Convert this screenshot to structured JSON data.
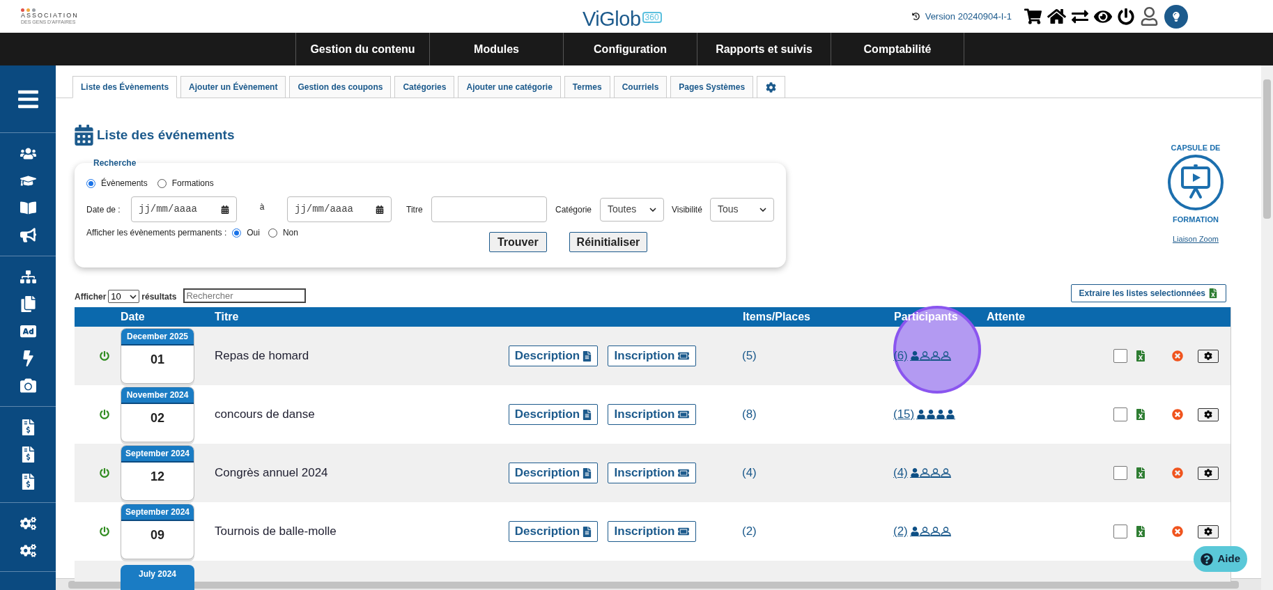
{
  "header": {
    "logo_title": "ASSOCIATION",
    "logo_subtitle": "DES GENS D'AFFAIRES",
    "brand": "ViGlob",
    "brand_badge": "360",
    "version": "Version 20240904-I-1"
  },
  "nav": [
    "Gestion du contenu",
    "Modules",
    "Configuration",
    "Rapports et suivis",
    "Comptabilité"
  ],
  "tabs": [
    {
      "label": "Liste des Évènements",
      "selected": true
    },
    {
      "label": "Ajouter un Évènement",
      "selected": false
    },
    {
      "label": "Gestion des coupons",
      "selected": false
    },
    {
      "label": "Catégories",
      "selected": false
    },
    {
      "label": "Ajouter une catégorie",
      "selected": false
    },
    {
      "label": "Termes",
      "selected": false
    },
    {
      "label": "Courriels",
      "selected": false
    },
    {
      "label": "Pages Systèmes",
      "selected": false
    }
  ],
  "page_title": "Liste des événements",
  "search": {
    "legend": "Recherche",
    "types": [
      {
        "label": "Évènements",
        "selected": true
      },
      {
        "label": "Formations",
        "selected": false
      }
    ],
    "date_from_label": "Date de :",
    "date_from_placeholder": "jj/mm/aaaa",
    "date_to_label": "à",
    "date_to_placeholder": "jj/mm/aaaa",
    "title_label": "Titre",
    "category_label": "Catégorie",
    "category_value": "Toutes",
    "visibility_label": "Visibilité",
    "visibility_value": "Tous",
    "permanent_label": "Afficher les évènements permanents :",
    "permanent_options": [
      {
        "label": "Oui",
        "selected": true
      },
      {
        "label": "Non",
        "selected": false
      }
    ],
    "find_button": "Trouver",
    "reset_button": "Réinitialiser"
  },
  "capsule": {
    "top": "CAPSULE DE",
    "bottom": "FORMATION",
    "link": "Liaison Zoom"
  },
  "show_label": "Afficher",
  "show_value": "10",
  "results_label": "résultats",
  "filter_placeholder": "Rechercher",
  "extract_button": "Extraire les listes selectionnées",
  "table": {
    "columns": [
      "Date",
      "Titre",
      "Items/Places",
      "Participants",
      "Attente"
    ],
    "rows": [
      {
        "active": true,
        "month": "December 2025",
        "day": "01",
        "title": "Repas de homard",
        "description": "Description",
        "inscription": "Inscription",
        "items": "(5)",
        "participants": "(6)",
        "people": [
          true,
          false,
          false,
          false
        ],
        "checked": false
      },
      {
        "active": true,
        "month": "November 2024",
        "day": "02",
        "title": "concours de danse",
        "description": "Description",
        "inscription": "Inscription",
        "items": "(8)",
        "participants": "(15)",
        "people": [
          true,
          true,
          true,
          true
        ],
        "checked": false
      },
      {
        "active": true,
        "month": "September 2024",
        "day": "12",
        "title": "Congrès annuel 2024",
        "description": "Description",
        "inscription": "Inscription",
        "items": "(4)",
        "participants": "(4)",
        "people": [
          true,
          false,
          false,
          false
        ],
        "checked": false
      },
      {
        "active": true,
        "month": "September 2024",
        "day": "09",
        "title": "Tournois de balle-molle",
        "description": "Description",
        "inscription": "Inscription",
        "items": "(2)",
        "participants": "(2)",
        "people": [
          true,
          false,
          false,
          false
        ],
        "checked": false
      }
    ],
    "partial_row": {
      "month": "July 2024"
    }
  },
  "help_button": "Aide"
}
